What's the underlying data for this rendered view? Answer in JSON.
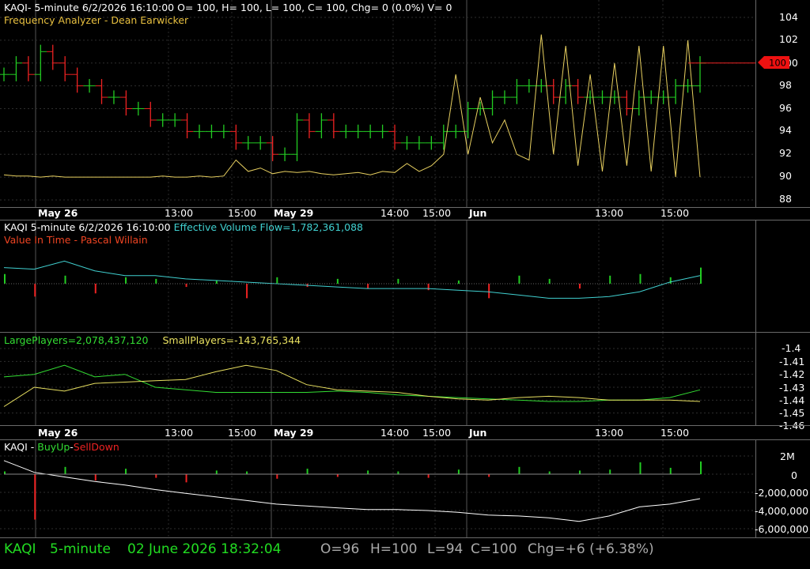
{
  "header_price": "KAQI- 5-minute 6/2/2026 16:10:00 O= 100, H= 100, L= 100, C= 100, Chg= 0 (0.0%) V= 0",
  "indicator_freq": "Frequency Analyzer - Dean Earwicker",
  "header_vol_prefix": "KAQI 5-minute  6/2/2026 16:10:00",
  "header_vol_flow": "Effective Volume Flow=1,782,361,088",
  "indicator_vit": "Value In Time - Pascal Willain",
  "large_players": "LargePlayers=2,078,437,120",
  "small_players": "SmallPlayers=-143,765,344",
  "buyup_prefix": "KAQI - ",
  "buyup_label": "BuyUp",
  "buyup_dash": "-",
  "selldown_label": "SellDown",
  "last_price_tag": "100",
  "status": {
    "symbol": "KAQI",
    "interval": "5-minute",
    "datetime": "02 June 2026 18:32:04",
    "open": "O=96",
    "high": "H=100",
    "low": "L=94",
    "close": "C=100",
    "change": "Chg=+6 (+6.38%)"
  },
  "x_axis_labels": [
    "May 26",
    "13:00",
    "15:00",
    "May 29",
    "14:00",
    "15:00",
    "Jun",
    "13:00",
    "15:00"
  ],
  "colors": {
    "up": "#22cc22",
    "down": "#ee2222",
    "freq": "#e8d060",
    "flow": "#40d0d0",
    "large": "#33dd33",
    "small": "#e8e060",
    "status": "#22dd22",
    "tag": "#ee1111"
  },
  "chart_data": [
    {
      "type": "line",
      "title": "KAQI 5-minute price bars with Frequency Analyzer",
      "y_ticks": [
        "104",
        "102",
        "100",
        "98",
        "96",
        "94",
        "92",
        "90",
        "88"
      ],
      "ylim": [
        87,
        105
      ],
      "x_session_labels": [
        "May 26",
        "13:00",
        "15:00",
        "May 29",
        "14:00",
        "15:00",
        "Jun",
        "13:00",
        "15:00"
      ],
      "series": [
        {
          "name": "Price",
          "values": [
            99,
            100,
            99,
            101,
            100,
            99,
            98,
            98,
            97,
            97,
            96,
            96,
            95,
            95,
            95,
            94,
            94,
            94,
            94,
            93,
            93,
            93,
            92,
            92,
            95,
            94,
            95,
            94,
            94,
            94,
            94,
            94,
            93,
            93,
            93,
            93,
            94,
            94,
            96,
            96,
            97,
            97,
            98,
            98,
            98,
            97,
            98,
            97,
            97,
            97,
            97,
            96,
            97,
            97,
            97,
            98,
            98,
            100
          ]
        },
        {
          "name": "Frequency Analyzer",
          "values": [
            90.2,
            90.1,
            90.1,
            90.0,
            90.1,
            90.0,
            90.0,
            90.0,
            90.0,
            90.0,
            90.0,
            90.0,
            90.0,
            90.1,
            90.0,
            90.0,
            90.1,
            90.0,
            90.1,
            91.5,
            90.5,
            90.8,
            90.3,
            90.5,
            90.4,
            90.5,
            90.3,
            90.2,
            90.3,
            90.4,
            90.2,
            90.5,
            90.4,
            91.2,
            90.5,
            91.0,
            92.0,
            99.0,
            92.0,
            97.0,
            93.0,
            95.0,
            92.0,
            91.5,
            102.5,
            92.0,
            101.5,
            91.0,
            99.0,
            90.5,
            100.0,
            91.0,
            101.5,
            90.5,
            101.5,
            90.0,
            102.0,
            90.0
          ]
        }
      ]
    },
    {
      "type": "bar",
      "title": "Effective Volume Flow / Value In Time",
      "series": [
        {
          "name": "Effective Volume Flow",
          "values": [
            1.0,
            0.9,
            1.4,
            0.8,
            0.5,
            0.5,
            0.3,
            0.2,
            0.1,
            0.0,
            -0.1,
            -0.2,
            -0.3,
            -0.3,
            -0.3,
            -0.4,
            -0.5,
            -0.7,
            -0.9,
            -0.9,
            -0.8,
            -0.5,
            0.1,
            0.5
          ]
        },
        {
          "name": "Volume",
          "values": [
            0.6,
            -0.8,
            0.5,
            -0.6,
            0.4,
            0.3,
            -0.2,
            0.2,
            -0.9,
            0.4,
            -0.2,
            0.3,
            -0.3,
            0.3,
            -0.4,
            0.2,
            -0.9,
            0.5,
            0.3,
            -0.3,
            0.5,
            0.6,
            0.4,
            1.0
          ]
        }
      ]
    },
    {
      "type": "line",
      "title": "LargePlayers / SmallPlayers",
      "y_ticks": [
        "-1.4",
        "-1.41",
        "-1.42",
        "-1.43",
        "-1.44",
        "-1.45",
        "-1.46"
      ],
      "ylim": [
        -1.46,
        -1.4
      ],
      "series": [
        {
          "name": "LargePlayers",
          "values": [
            -1.422,
            -1.42,
            -1.413,
            -1.422,
            -1.42,
            -1.43,
            -1.432,
            -1.434,
            -1.434,
            -1.434,
            -1.434,
            -1.433,
            -1.434,
            -1.436,
            -1.437,
            -1.438,
            -1.439,
            -1.44,
            -1.441,
            -1.441,
            -1.44,
            -1.44,
            -1.438,
            -1.432
          ]
        },
        {
          "name": "SmallPlayers",
          "values": [
            -1.445,
            -1.43,
            -1.433,
            -1.427,
            -1.426,
            -1.425,
            -1.424,
            -1.418,
            -1.413,
            -1.417,
            -1.428,
            -1.432,
            -1.433,
            -1.434,
            -1.437,
            -1.439,
            -1.44,
            -1.438,
            -1.437,
            -1.438,
            -1.44,
            -1.44,
            -1.44,
            -1.441
          ]
        }
      ]
    },
    {
      "type": "bar",
      "title": "KAQI - BuyUp-SellDown",
      "y_ticks": [
        "2M",
        "0",
        "-2,000,000",
        "-4,000,000",
        "-6,000,000"
      ],
      "ylim": [
        -6500000,
        3000000
      ],
      "series": [
        {
          "name": "BuyUp-SellDown",
          "values": [
            300000,
            -5000000,
            800000,
            -700000,
            600000,
            -400000,
            -900000,
            400000,
            300000,
            -500000,
            600000,
            -300000,
            400000,
            300000,
            -400000,
            500000,
            -300000,
            800000,
            300000,
            400000,
            500000,
            1300000,
            700000,
            1400000
          ]
        },
        {
          "name": "Cumulative",
          "values": [
            1500000,
            200000,
            -300000,
            -800000,
            -1200000,
            -1700000,
            -2100000,
            -2500000,
            -2900000,
            -3300000,
            -3500000,
            -3700000,
            -3900000,
            -3900000,
            -4000000,
            -4200000,
            -4500000,
            -4600000,
            -4800000,
            -5200000,
            -4600000,
            -3600000,
            -3300000,
            -2700000
          ]
        }
      ]
    }
  ]
}
